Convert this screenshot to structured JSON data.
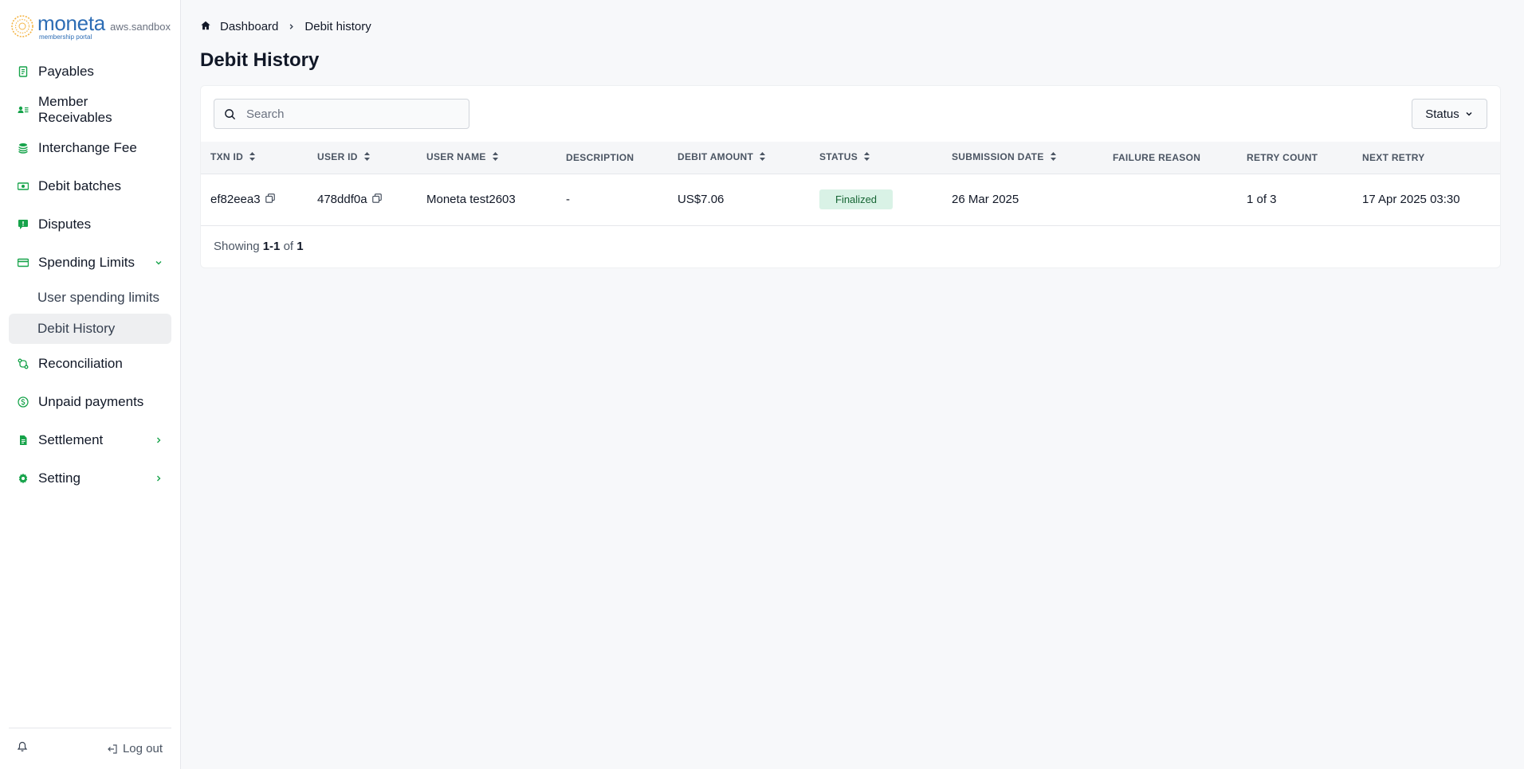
{
  "sidebar": {
    "brand": {
      "name": "moneta",
      "subtitle": "membership portal",
      "env": "aws.sandbox"
    },
    "items": [
      {
        "label": "Payables",
        "icon": "receipt-icon"
      },
      {
        "label": "Member Receivables",
        "icon": "member-list-icon"
      },
      {
        "label": "Interchange Fee",
        "icon": "coin-stack-icon"
      },
      {
        "label": "Debit batches",
        "icon": "banknote-icon"
      },
      {
        "label": "Disputes",
        "icon": "alert-chat-icon"
      },
      {
        "label": "Spending Limits",
        "icon": "credit-card-icon",
        "expanded": true,
        "children": [
          {
            "label": "User spending limits"
          },
          {
            "label": "Debit History",
            "active": true
          }
        ]
      },
      {
        "label": "Reconciliation",
        "icon": "reconcile-icon"
      },
      {
        "label": "Unpaid payments",
        "icon": "dollar-circle-icon"
      },
      {
        "label": "Settlement",
        "icon": "document-icon"
      },
      {
        "label": "Setting",
        "icon": "gear-icon"
      }
    ],
    "footer": {
      "logout_label": "Log out"
    }
  },
  "breadcrumb": {
    "home": "Dashboard",
    "current": "Debit history"
  },
  "page": {
    "title": "Debit History"
  },
  "toolbar": {
    "search_placeholder": "Search",
    "search_value": "",
    "status_label": "Status"
  },
  "table": {
    "columns": [
      "TXN ID",
      "USER ID",
      "USER NAME",
      "DESCRIPTION",
      "DEBIT AMOUNT",
      "STATUS",
      "SUBMISSION DATE",
      "FAILURE REASON",
      "RETRY COUNT",
      "NEXT RETRY"
    ],
    "rows": [
      {
        "txn_id": "ef82eea3",
        "user_id": "478ddf0a",
        "user_name": "Moneta test2603",
        "description": "-",
        "debit_amount": "US$7.06",
        "status": "Finalized",
        "submission_date": "26 Mar 2025",
        "failure_reason": "",
        "retry_count": "1 of 3",
        "next_retry": "17 Apr 2025 03:30"
      }
    ]
  },
  "pagination": {
    "prefix": "Showing",
    "range": "1-1",
    "of": "of",
    "total": "1"
  },
  "colors": {
    "accent": "#16a34a",
    "brand": "#2d6db5",
    "badge_bg": "#d9f2e6",
    "badge_text": "#166534"
  }
}
